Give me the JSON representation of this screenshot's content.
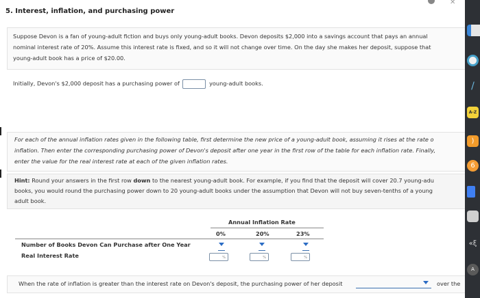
{
  "title": "5. Interest, inflation, and purchasing power",
  "intro": {
    "line1": "Suppose Devon is a fan of young-adult fiction and buys only young-adult books. Devon deposits $2,000 into a savings account that pays an annual",
    "line2": "nominal interest rate of 20%. Assume this interest rate is fixed, and so it will not change over time. On the day she makes her deposit, suppose that",
    "line3": "young-adult book has a price of $20.00."
  },
  "initial": {
    "prefix": "Initially, Devon's $2,000 deposit has a purchasing power of",
    "suffix": "young-adult books."
  },
  "instructions": {
    "line1": "For each of the annual inflation rates given in the following table, first determine the new price of a young-adult book, assuming it rises at the rate o",
    "line2": "inflation. Then enter the corresponding purchasing power of Devon's deposit after one year in the first row of the table for each inflation rate. Finally,",
    "line3": "enter the value for the real interest rate at each of the given inflation rates."
  },
  "hint": {
    "label": "Hint:",
    "line1_a": " Round your answers in the first row ",
    "line1_b": "down",
    "line1_c": " to the nearest young-adult book. For example, if you find that the deposit will cover 20.7 young-adu",
    "line2": "books, you would round the purchasing power down to 20 young-adult books under the assumption that Devon will not buy seven-tenths of a young",
    "line3": "adult book."
  },
  "table": {
    "group_header": "Annual Inflation Rate",
    "columns": [
      "0%",
      "20%",
      "23%"
    ],
    "rows": [
      "Number of Books Devon Can Purchase after One Year",
      "Real Interest Rate"
    ],
    "pct_suffix": "%"
  },
  "conclusion": {
    "text": "When the rate of inflation is greater than the interest rate on Devon's deposit, the purchasing power of her deposit",
    "after": "over the"
  },
  "dock": {
    "atoz_label": "A-Z"
  }
}
